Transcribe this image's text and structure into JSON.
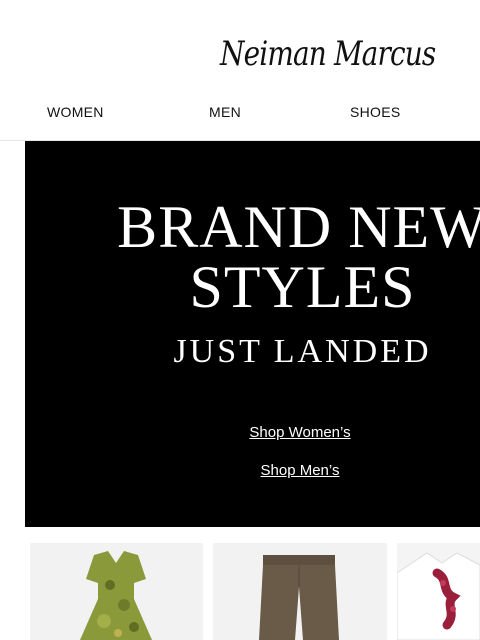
{
  "brand": {
    "logo_text": "Neiman Marcus"
  },
  "nav": {
    "items": [
      "WOMEN",
      "MEN",
      "SHOES"
    ]
  },
  "hero": {
    "line1": "BRAND NEW",
    "line2": "STYLES",
    "line3": "JUST LANDED",
    "links": [
      "Shop Women’s",
      "Shop Men’s"
    ]
  },
  "products": [
    {
      "icon": "floral-dress-icon",
      "color": "#8a9a3a"
    },
    {
      "icon": "trousers-icon",
      "color": "#6a5a48"
    },
    {
      "icon": "embellished-shirt-icon",
      "color": "#9a1f3a"
    }
  ]
}
